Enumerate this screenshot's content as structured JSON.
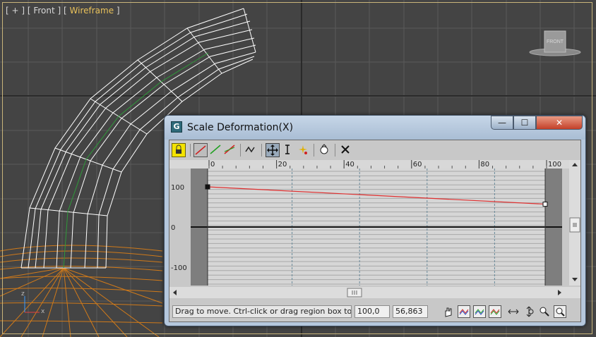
{
  "viewport": {
    "label_prefix": "[ + ] [ Front ] [ ",
    "label_mode": "Wireframe",
    "label_suffix": " ]",
    "viewcube_label": "FRONT",
    "axis_z": "z",
    "axis_x": "x",
    "colors": {
      "bg": "#444444",
      "grid": "#5a5a5a",
      "mesh": "#ffffff",
      "ground": "#d07a1a"
    }
  },
  "dialog": {
    "title": "Scale Deformation(X)",
    "min_glyph": "—",
    "max_glyph": "☐",
    "close_glyph": "✕"
  },
  "toolbar": {
    "icons": [
      "lock-symmetry-icon",
      "display-x-curve-icon",
      "display-y-curve-icon",
      "display-xy-curves-icon",
      "swap-curves-icon",
      "move-control-point-icon",
      "scale-control-point-icon",
      "insert-corner-point-icon",
      "delete-control-point-icon",
      "reset-curve-icon"
    ]
  },
  "graph": {
    "x_ticks": [
      "0",
      "20",
      "40",
      "60",
      "80",
      "100"
    ],
    "y_ticks": [
      "100",
      "0",
      "-100"
    ],
    "curve_color": "#e03030",
    "points": [
      {
        "x": 0,
        "y": 100
      },
      {
        "x": 100,
        "y": 56.863
      }
    ]
  },
  "status": {
    "text": "Drag to move. Ctrl-click or drag region box to add to",
    "field_x": "100,0",
    "field_y": "56,863"
  },
  "status_icons": [
    "pan-icon",
    "zoom-extents-icon",
    "zoom-horizontal-extents-icon",
    "zoom-vertical-extents-icon",
    "zoom-horizontal-icon",
    "zoom-vertical-icon",
    "zoom-icon",
    "zoom-region-icon"
  ]
}
